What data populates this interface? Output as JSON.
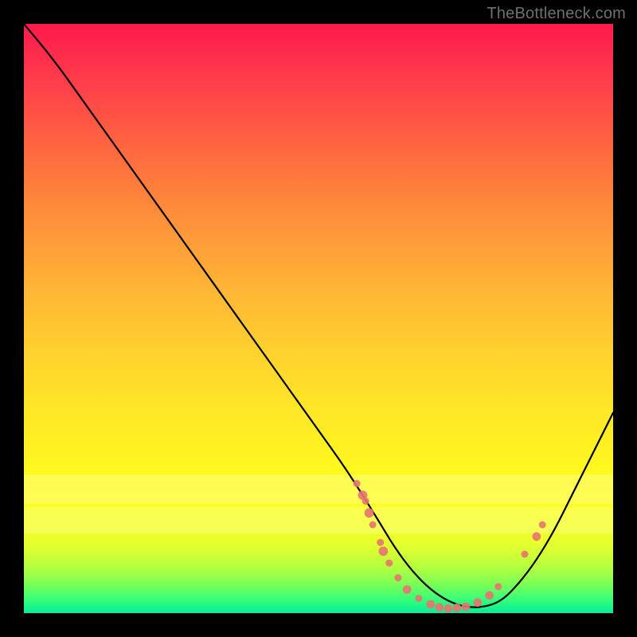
{
  "attribution": "TheBottleneck.com",
  "chart_data": {
    "type": "line",
    "title": "",
    "xlabel": "",
    "ylabel": "",
    "xlim": [
      0,
      100
    ],
    "ylim": [
      0,
      100
    ],
    "series": [
      {
        "name": "bottleneck-curve",
        "x": [
          0,
          5,
          10,
          15,
          20,
          25,
          30,
          35,
          40,
          45,
          50,
          55,
          60,
          63,
          66,
          69,
          72,
          75,
          78,
          81,
          84,
          87,
          90,
          93,
          96,
          100
        ],
        "y": [
          100,
          94,
          87,
          80,
          73,
          66,
          59,
          52,
          45,
          38,
          31,
          24,
          16,
          11,
          7,
          4,
          2,
          1,
          1,
          2,
          5,
          9,
          14,
          20,
          26,
          34
        ]
      }
    ],
    "markers": [
      {
        "x": 56.5,
        "y": 22.0,
        "r": 1.0
      },
      {
        "x": 57.5,
        "y": 20.0,
        "r": 1.3
      },
      {
        "x": 58.0,
        "y": 19.0,
        "r": 1.0
      },
      {
        "x": 58.6,
        "y": 17.0,
        "r": 1.3
      },
      {
        "x": 59.2,
        "y": 15.0,
        "r": 1.0
      },
      {
        "x": 60.5,
        "y": 12.0,
        "r": 1.0
      },
      {
        "x": 61.0,
        "y": 10.5,
        "r": 1.3
      },
      {
        "x": 62.0,
        "y": 8.5,
        "r": 1.0
      },
      {
        "x": 63.5,
        "y": 6.0,
        "r": 1.0
      },
      {
        "x": 65.0,
        "y": 4.0,
        "r": 1.2
      },
      {
        "x": 67.0,
        "y": 2.5,
        "r": 1.0
      },
      {
        "x": 69.0,
        "y": 1.5,
        "r": 1.2
      },
      {
        "x": 70.5,
        "y": 1.0,
        "r": 1.2
      },
      {
        "x": 72.0,
        "y": 0.8,
        "r": 1.2
      },
      {
        "x": 73.5,
        "y": 0.9,
        "r": 1.2
      },
      {
        "x": 75.0,
        "y": 1.1,
        "r": 1.2
      },
      {
        "x": 77.0,
        "y": 1.8,
        "r": 1.2
      },
      {
        "x": 79.0,
        "y": 3.0,
        "r": 1.2
      },
      {
        "x": 80.5,
        "y": 4.5,
        "r": 1.0
      },
      {
        "x": 85.0,
        "y": 10.0,
        "r": 1.0
      },
      {
        "x": 87.0,
        "y": 13.0,
        "r": 1.2
      },
      {
        "x": 88.0,
        "y": 15.0,
        "r": 1.0
      }
    ],
    "gradient_stops": [
      {
        "pos": 0,
        "color": "#ff1a4d"
      },
      {
        "pos": 50,
        "color": "#ffd22e"
      },
      {
        "pos": 100,
        "color": "#0de89a"
      }
    ]
  }
}
